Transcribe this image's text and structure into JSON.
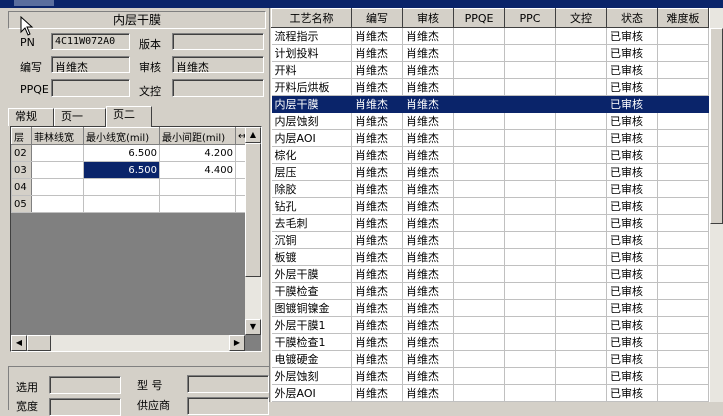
{
  "process_title": "内层干膜",
  "info": {
    "pn_label": "PN",
    "pn_value": "4C11W072A0",
    "version_label": "版本",
    "version_value": "",
    "writer_label": "编写",
    "writer_value": "肖维杰",
    "reviewer_label": "审核",
    "reviewer_value": "肖维杰",
    "ppqe_label": "PPQE",
    "ppqe_value": "",
    "wenkong_label": "文控",
    "wenkong_value": ""
  },
  "tabs": [
    "常规",
    "页一",
    "页二"
  ],
  "subgrid": {
    "headers": [
      "层",
      "菲林线宽",
      "最小线宽(mil)",
      "最小间距(mil)"
    ],
    "rows": [
      {
        "layer": "02",
        "film": "",
        "min_width": "6.500",
        "min_space": "4.200"
      },
      {
        "layer": "03",
        "film": "",
        "min_width": "6.500",
        "min_space": "4.400"
      },
      {
        "layer": "04",
        "film": "",
        "min_width": "",
        "min_space": ""
      },
      {
        "layer": "05",
        "film": "",
        "min_width": "",
        "min_space": ""
      }
    ]
  },
  "bottom": {
    "select_label": "选用",
    "type_label": "型  号",
    "width_label": "宽度",
    "supplier_label": "供应商"
  },
  "process_table": {
    "headers": [
      "工艺名称",
      "编写",
      "审核",
      "PPQE",
      "PPC",
      "文控",
      "状态",
      "难度板"
    ],
    "rows": [
      {
        "name": "流程指示",
        "writer": "肖维杰",
        "reviewer": "肖维杰",
        "ppqe": "",
        "ppc": "",
        "wenkong": "",
        "status": "已审核",
        "difficulty": ""
      },
      {
        "name": "计划投料",
        "writer": "肖维杰",
        "reviewer": "肖维杰",
        "ppqe": "",
        "ppc": "",
        "wenkong": "",
        "status": "已审核",
        "difficulty": ""
      },
      {
        "name": "开料",
        "writer": "肖维杰",
        "reviewer": "肖维杰",
        "ppqe": "",
        "ppc": "",
        "wenkong": "",
        "status": "已审核",
        "difficulty": ""
      },
      {
        "name": "开料后烘板",
        "writer": "肖维杰",
        "reviewer": "肖维杰",
        "ppqe": "",
        "ppc": "",
        "wenkong": "",
        "status": "已审核",
        "difficulty": ""
      },
      {
        "name": "内层干膜",
        "writer": "肖维杰",
        "reviewer": "肖维杰",
        "ppqe": "",
        "ppc": "",
        "wenkong": "",
        "status": "已审核",
        "difficulty": "",
        "selected": true
      },
      {
        "name": "内层蚀刻",
        "writer": "肖维杰",
        "reviewer": "肖维杰",
        "ppqe": "",
        "ppc": "",
        "wenkong": "",
        "status": "已审核",
        "difficulty": ""
      },
      {
        "name": "内层AOI",
        "writer": "肖维杰",
        "reviewer": "肖维杰",
        "ppqe": "",
        "ppc": "",
        "wenkong": "",
        "status": "已审核",
        "difficulty": ""
      },
      {
        "name": "棕化",
        "writer": "肖维杰",
        "reviewer": "肖维杰",
        "ppqe": "",
        "ppc": "",
        "wenkong": "",
        "status": "已审核",
        "difficulty": ""
      },
      {
        "name": "层压",
        "writer": "肖维杰",
        "reviewer": "肖维杰",
        "ppqe": "",
        "ppc": "",
        "wenkong": "",
        "status": "已审核",
        "difficulty": ""
      },
      {
        "name": "除胶",
        "writer": "肖维杰",
        "reviewer": "肖维杰",
        "ppqe": "",
        "ppc": "",
        "wenkong": "",
        "status": "已审核",
        "difficulty": ""
      },
      {
        "name": "钻孔",
        "writer": "肖维杰",
        "reviewer": "肖维杰",
        "ppqe": "",
        "ppc": "",
        "wenkong": "",
        "status": "已审核",
        "difficulty": ""
      },
      {
        "name": "去毛刺",
        "writer": "肖维杰",
        "reviewer": "肖维杰",
        "ppqe": "",
        "ppc": "",
        "wenkong": "",
        "status": "已审核",
        "difficulty": ""
      },
      {
        "name": "沉铜",
        "writer": "肖维杰",
        "reviewer": "肖维杰",
        "ppqe": "",
        "ppc": "",
        "wenkong": "",
        "status": "已审核",
        "difficulty": ""
      },
      {
        "name": "板镀",
        "writer": "肖维杰",
        "reviewer": "肖维杰",
        "ppqe": "",
        "ppc": "",
        "wenkong": "",
        "status": "已审核",
        "difficulty": ""
      },
      {
        "name": "外层干膜",
        "writer": "肖维杰",
        "reviewer": "肖维杰",
        "ppqe": "",
        "ppc": "",
        "wenkong": "",
        "status": "已审核",
        "difficulty": ""
      },
      {
        "name": "干膜检查",
        "writer": "肖维杰",
        "reviewer": "肖维杰",
        "ppqe": "",
        "ppc": "",
        "wenkong": "",
        "status": "已审核",
        "difficulty": ""
      },
      {
        "name": "图镀铜镍金",
        "writer": "肖维杰",
        "reviewer": "肖维杰",
        "ppqe": "",
        "ppc": "",
        "wenkong": "",
        "status": "已审核",
        "difficulty": ""
      },
      {
        "name": "外层干膜1",
        "writer": "肖维杰",
        "reviewer": "肖维杰",
        "ppqe": "",
        "ppc": "",
        "wenkong": "",
        "status": "已审核",
        "difficulty": ""
      },
      {
        "name": "干膜检查1",
        "writer": "肖维杰",
        "reviewer": "肖维杰",
        "ppqe": "",
        "ppc": "",
        "wenkong": "",
        "status": "已审核",
        "difficulty": ""
      },
      {
        "name": "电镀硬金",
        "writer": "肖维杰",
        "reviewer": "肖维杰",
        "ppqe": "",
        "ppc": "",
        "wenkong": "",
        "status": "已审核",
        "difficulty": ""
      },
      {
        "name": "外层蚀刻",
        "writer": "肖维杰",
        "reviewer": "肖维杰",
        "ppqe": "",
        "ppc": "",
        "wenkong": "",
        "status": "已审核",
        "difficulty": ""
      },
      {
        "name": "外层AOI",
        "writer": "肖维杰",
        "reviewer": "肖维杰",
        "ppqe": "",
        "ppc": "",
        "wenkong": "",
        "status": "已审核",
        "difficulty": ""
      }
    ]
  },
  "colors": {
    "window_face": "#d4d0c8",
    "selection": "#0a246a",
    "title_bar": "#0a246a"
  },
  "icons": [
    "cursor-arrow-icon",
    "scroll-up-icon",
    "scroll-down-icon",
    "scroll-left-icon",
    "scroll-right-icon"
  ]
}
